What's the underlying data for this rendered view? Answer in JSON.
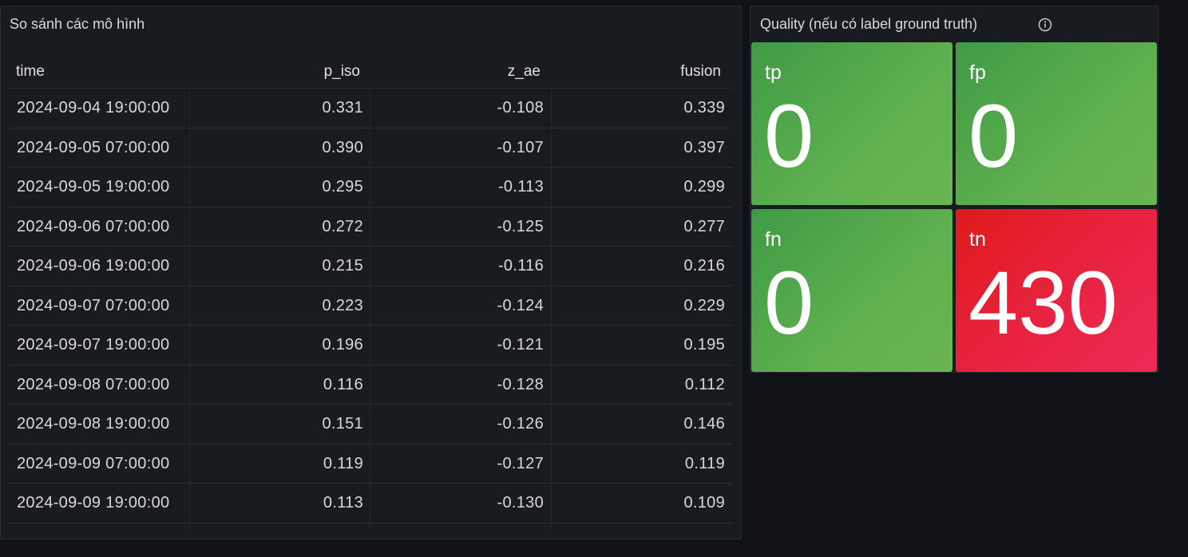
{
  "table_panel": {
    "title": "So sánh các mô hình",
    "columns": {
      "time": "time",
      "p_iso": "p_iso",
      "z_ae": "z_ae",
      "fusion": "fusion"
    },
    "rows": [
      {
        "time": "2024-09-04 19:00:00",
        "p_iso": "0.331",
        "z_ae": "-0.108",
        "fusion": "0.339"
      },
      {
        "time": "2024-09-05 07:00:00",
        "p_iso": "0.390",
        "z_ae": "-0.107",
        "fusion": "0.397"
      },
      {
        "time": "2024-09-05 19:00:00",
        "p_iso": "0.295",
        "z_ae": "-0.113",
        "fusion": "0.299"
      },
      {
        "time": "2024-09-06 07:00:00",
        "p_iso": "0.272",
        "z_ae": "-0.125",
        "fusion": "0.277"
      },
      {
        "time": "2024-09-06 19:00:00",
        "p_iso": "0.215",
        "z_ae": "-0.116",
        "fusion": "0.216"
      },
      {
        "time": "2024-09-07 07:00:00",
        "p_iso": "0.223",
        "z_ae": "-0.124",
        "fusion": "0.229"
      },
      {
        "time": "2024-09-07 19:00:00",
        "p_iso": "0.196",
        "z_ae": "-0.121",
        "fusion": "0.195"
      },
      {
        "time": "2024-09-08 07:00:00",
        "p_iso": "0.116",
        "z_ae": "-0.128",
        "fusion": "0.112"
      },
      {
        "time": "2024-09-08 19:00:00",
        "p_iso": "0.151",
        "z_ae": "-0.126",
        "fusion": "0.146"
      },
      {
        "time": "2024-09-09 07:00:00",
        "p_iso": "0.119",
        "z_ae": "-0.127",
        "fusion": "0.119"
      },
      {
        "time": "2024-09-09 19:00:00",
        "p_iso": "0.113",
        "z_ae": "-0.130",
        "fusion": "0.109"
      }
    ]
  },
  "quality_panel": {
    "title": "Quality (nếu có label ground truth)",
    "info_icon": "info-icon",
    "tiles": [
      {
        "label": "tp",
        "value": "0",
        "color": "#52a34a"
      },
      {
        "label": "fp",
        "value": "0",
        "color": "#52a34a"
      },
      {
        "label": "fn",
        "value": "0",
        "color": "#52a34a"
      },
      {
        "label": "tn",
        "value": "430",
        "color": "#e5263c"
      }
    ]
  }
}
